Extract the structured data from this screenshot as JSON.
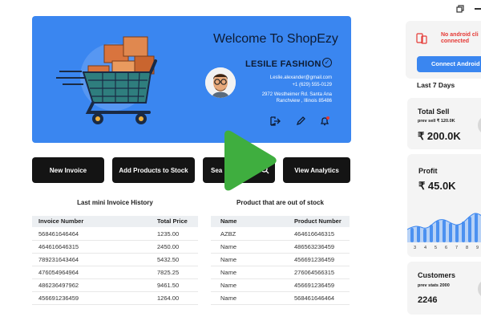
{
  "hero": {
    "title": "Welcome To ShopEzy",
    "store_name": "LESILE FASHION",
    "email": "Leslie.alexander@gmail.com",
    "phone": "+1 (629) 555-0129",
    "address_line1": "2972 Westheimer Rd. Santa Ana",
    "address_line2": "Ranchview , Illinois 85486",
    "icons": [
      "logout-icon",
      "edit-icon",
      "notification-bell-icon"
    ]
  },
  "actions": {
    "new_invoice": "New Invoice",
    "add_products": "Add Products to Stock",
    "search": "Sea",
    "view_analytics": "View Analytics"
  },
  "invoice_history": {
    "title": "Last mini Invoice History",
    "columns": [
      "Invoice Number",
      "Total Price"
    ],
    "rows": [
      [
        "568461646464",
        "1235.00"
      ],
      [
        "464616646315",
        "2450.00"
      ],
      [
        "789231643464",
        "5432.50"
      ],
      [
        "476054964964",
        "7825.25"
      ],
      [
        "486236497962",
        "9461.50"
      ],
      [
        "456691236459",
        "1264.00"
      ]
    ]
  },
  "out_of_stock": {
    "title": "Product that are out of stock",
    "columns": [
      "Name",
      "Product Number"
    ],
    "rows": [
      [
        "AZBZ",
        "464616646315"
      ],
      [
        "Name",
        "486563236459"
      ],
      [
        "Name",
        "456691236459"
      ],
      [
        "Name",
        "276064566315"
      ],
      [
        "Name",
        "456691236459"
      ],
      [
        "Name",
        "568461646464"
      ]
    ]
  },
  "side_panel": {
    "android_status": "No android cli connected",
    "android_status_line1": "No android cli",
    "android_status_line2": "connected",
    "connect_button": "Connect Android",
    "period": "Last 7 Days",
    "total_sell": {
      "title": "Total Sell",
      "sub": "prev  sell ₹ 120.0K",
      "value": "₹ 200.0K"
    },
    "profit": {
      "title": "Profit",
      "value": "₹ 45.0K",
      "axis_labels": [
        "3",
        "4",
        "5",
        "6",
        "7",
        "8",
        "9"
      ]
    },
    "customers": {
      "title": "Customers",
      "sub": "prev stats 2000",
      "value": "2246"
    }
  },
  "colors": {
    "hero_bg": "#3a86f0",
    "button_bg": "#141414",
    "accent": "#3a86f0",
    "danger": "#e53935",
    "play_overlay": "#3fae3f"
  }
}
